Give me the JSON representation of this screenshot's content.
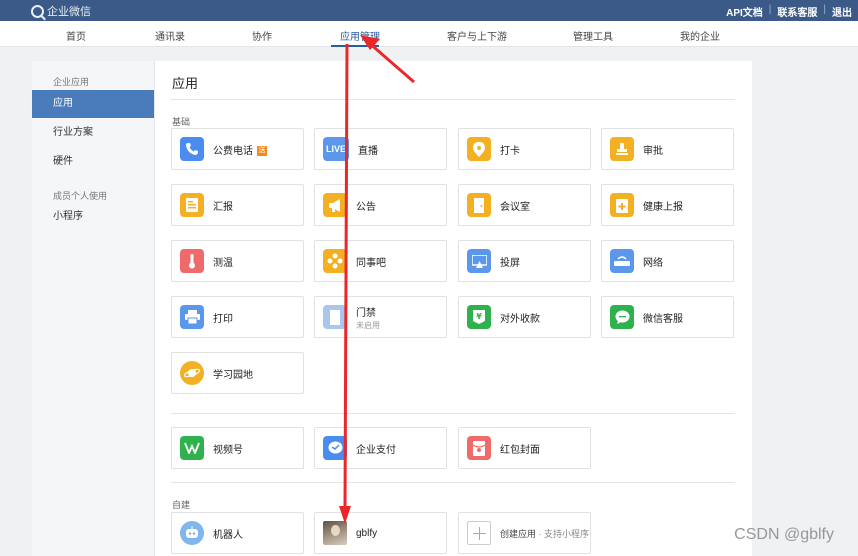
{
  "topbar": {
    "logo": "企业微信",
    "links": [
      "API文档",
      "联系客服",
      "退出"
    ]
  },
  "nav": {
    "items": [
      "首页",
      "通讯录",
      "协作",
      "应用管理",
      "客户与上下游",
      "管理工具",
      "我的企业"
    ],
    "active": "应用管理"
  },
  "sidebar": {
    "group1": "企业应用",
    "items1": [
      "应用",
      "行业方案",
      "硬件"
    ],
    "group2": "成员个人使用",
    "items2": [
      "小程序"
    ]
  },
  "content": {
    "title": "应用",
    "section_basic": "基础",
    "section_custom": "自建",
    "apps": [
      {
        "label": "公费电话",
        "badge": "送",
        "color": "#4a8cf0",
        "icon": "phone-icon"
      },
      {
        "label": "直播",
        "color": "#5b97ea",
        "icon": "live-icon",
        "glyph": "LIVE"
      },
      {
        "label": "打卡",
        "color": "#f4b023",
        "icon": "location-icon"
      },
      {
        "label": "审批",
        "color": "#f4b023",
        "icon": "stamp-icon"
      },
      {
        "label": "汇报",
        "color": "#f4b023",
        "icon": "report-icon"
      },
      {
        "label": "公告",
        "color": "#f4b023",
        "icon": "megaphone-icon"
      },
      {
        "label": "会议室",
        "color": "#f4b023",
        "icon": "door-icon"
      },
      {
        "label": "健康上报",
        "color": "#f4b023",
        "icon": "health-icon"
      },
      {
        "label": "测温",
        "color": "#ef6b6b",
        "icon": "thermometer-icon"
      },
      {
        "label": "同事吧",
        "color": "#f4b023",
        "icon": "network-icon"
      },
      {
        "label": "投屏",
        "color": "#5b97ea",
        "icon": "screen-icon"
      },
      {
        "label": "网络",
        "color": "#5b97ea",
        "icon": "router-icon"
      },
      {
        "label": "打印",
        "color": "#5b97ea",
        "icon": "printer-icon"
      },
      {
        "label": "门禁",
        "sub": "未启用",
        "color": "#a9c7ee",
        "icon": "door-access-icon"
      },
      {
        "label": "对外收款",
        "color": "#2fb24e",
        "icon": "yuan-icon"
      },
      {
        "label": "微信客服",
        "color": "#2fb24e",
        "icon": "chat-icon"
      },
      {
        "label": "学习园地",
        "color": "#f4b023",
        "icon": "planet-icon"
      }
    ],
    "apps2": [
      {
        "label": "视频号",
        "color": "#2fb24e",
        "icon": "video-channel-icon"
      },
      {
        "label": "企业支付",
        "color": "#4a8cf0",
        "icon": "payment-icon"
      },
      {
        "label": "红包封面",
        "color": "#ef6b6b",
        "icon": "red-packet-icon"
      }
    ],
    "custom_apps": [
      {
        "label": "机器人",
        "color": "#7fb6ee",
        "icon": "robot-icon"
      },
      {
        "label": "gblfy",
        "icon": "app-photo-icon"
      }
    ],
    "create": {
      "label": "创建应用",
      "sub": "· 支持小程序"
    }
  },
  "watermark": "CSDN @gblfy",
  "annotation_color": "#e8282a"
}
